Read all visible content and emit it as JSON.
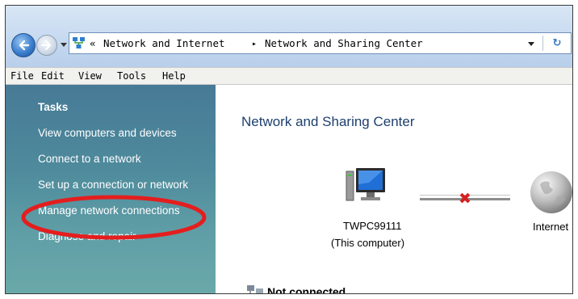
{
  "address_bar": {
    "breadcrumb_prefix": "«",
    "crumbs": [
      "Network and Internet",
      "Network and Sharing Center"
    ],
    "separator": "▸"
  },
  "menu": [
    "File",
    "Edit",
    "View",
    "Tools",
    "Help"
  ],
  "sidebar": {
    "title": "Tasks",
    "items": [
      "View computers and devices",
      "Connect to a network",
      "Set up a connection or network",
      "Manage network connections",
      "Diagnose and repair"
    ]
  },
  "main": {
    "title": "Network and Sharing Center",
    "computer_name": "TWPC99111",
    "computer_sub": "(This computer)",
    "internet_label": "Internet",
    "status": "Not connected"
  },
  "colors": {
    "highlight": "#e41e1e",
    "sidebar_top": "#477a96",
    "title_blue": "#1e3f6e"
  }
}
